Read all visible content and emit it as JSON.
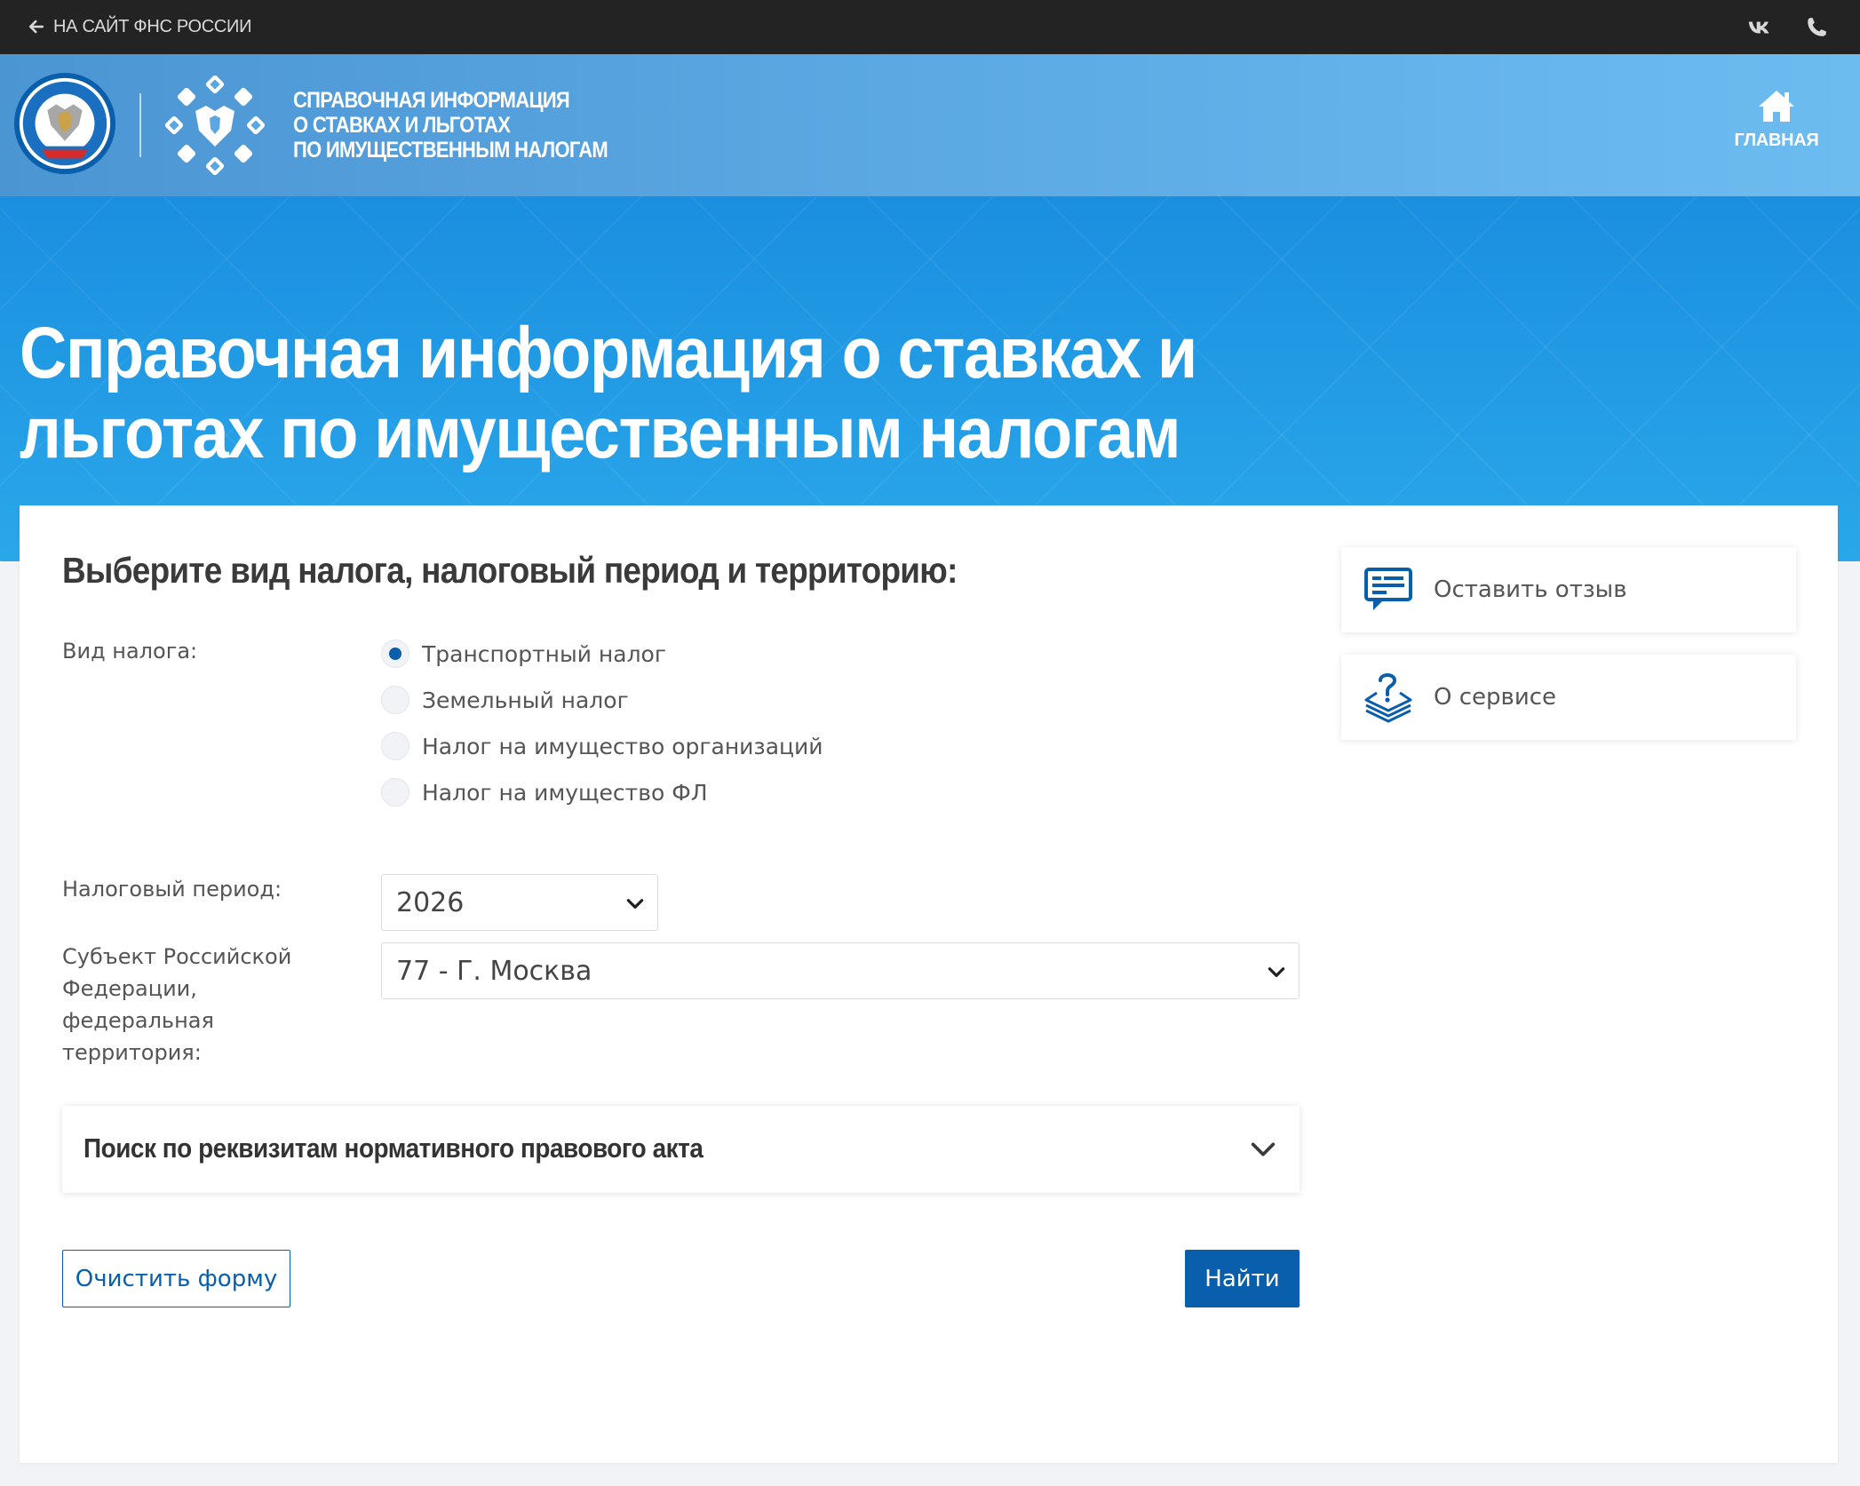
{
  "topbar": {
    "back_link": "НА САЙТ ФНС РОССИИ",
    "icons": [
      "vk-icon",
      "phone-icon"
    ]
  },
  "header": {
    "title_lines": [
      "СПРАВОЧНАЯ ИНФОРМАЦИЯ",
      "О СТАВКАХ И ЛЬГОТАХ",
      "ПО ИМУЩЕСТВЕННЫМ НАЛОГАМ"
    ],
    "home_label": "ГЛАВНАЯ"
  },
  "hero": {
    "title": "Справочная информация о ставках и льготах по имущественным налогам"
  },
  "form": {
    "heading": "Выберите вид налога, налоговый период и территорию:",
    "tax_type_label": "Вид налога:",
    "tax_types": [
      {
        "label": "Транспортный налог",
        "checked": true
      },
      {
        "label": "Земельный налог",
        "checked": false
      },
      {
        "label": "Налог на имущество организаций",
        "checked": false
      },
      {
        "label": "Налог на имущество ФЛ",
        "checked": false
      }
    ],
    "period_label": "Налоговый период:",
    "period_value": "2026",
    "region_label": "Субъект Российской Федерации, федеральная территория:",
    "region_value": "77 - Г. Москва",
    "accordion_title": "Поиск по реквизитам нормативного правового акта",
    "clear_button": "Очистить форму",
    "search_button": "Найти"
  },
  "sidebar": {
    "feedback": "Оставить отзыв",
    "about": "О сервисе"
  },
  "colors": {
    "primary": "#0a5fac",
    "topbar": "#232323",
    "header": "#5aa7e2",
    "hero": "#1f9ae4"
  }
}
